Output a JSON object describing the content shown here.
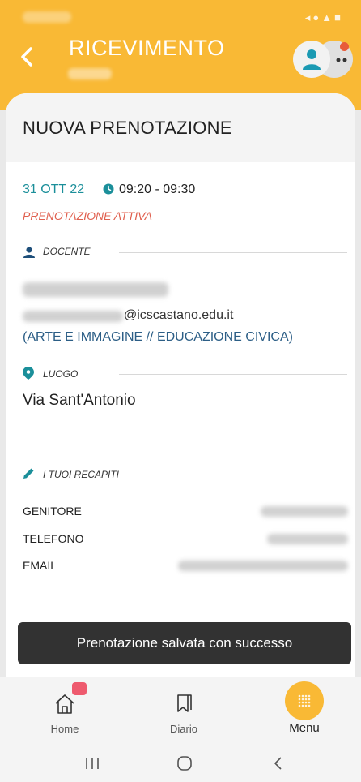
{
  "header": {
    "title": "RICEVIMENTO",
    "status_icons": "◂●▲■"
  },
  "section": {
    "title": "NUOVA PRENOTAZIONE"
  },
  "booking": {
    "date": "31 OTT 22",
    "time": "09:20 - 09:30",
    "status": "PRENOTAZIONE ATTIVA"
  },
  "teacher": {
    "section_label": "DOCENTE",
    "email_suffix": "@icscastano.edu.it",
    "subjects": "(ARTE E IMMAGINE // EDUCAZIONE CIVICA)"
  },
  "place": {
    "section_label": "LUOGO",
    "value": "Via Sant'Antonio"
  },
  "contacts": {
    "section_label": "I TUOI RECAPITI",
    "rows": [
      {
        "key": "GENITORE"
      },
      {
        "key": "TELEFONO"
      },
      {
        "key": "EMAIL"
      }
    ]
  },
  "toast": {
    "message": "Prenotazione salvata con successo"
  },
  "nav": {
    "home": "Home",
    "diary": "Diario",
    "menu": "Menu"
  },
  "colors": {
    "header": "#f9b935",
    "accent_teal": "#1b8f9a",
    "status_red": "#e0604f",
    "link_blue": "#2c5e86"
  },
  "icons": [
    "back-arrow-icon",
    "avatar-icon",
    "clock-icon",
    "person-icon",
    "location-pin-icon",
    "pencil-icon",
    "home-icon",
    "bookmark-icon",
    "grid-menu-icon",
    "recent-apps-icon",
    "home-circle-icon",
    "system-back-icon"
  ]
}
